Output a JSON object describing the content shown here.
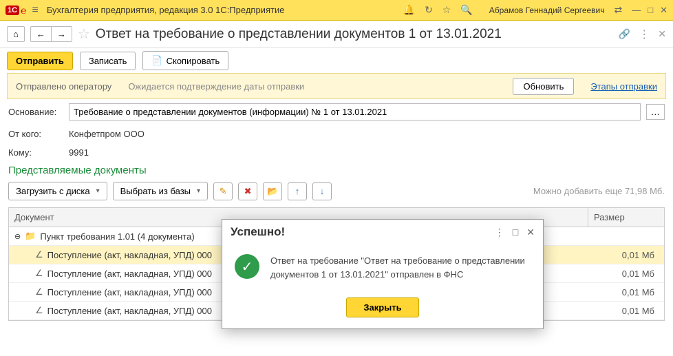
{
  "titlebar": {
    "logo_text": "℮",
    "app_title": "Бухгалтерия предприятия, редакция 3.0 1С:Предприятие",
    "user_name": "Абрамов Геннадий Сергеевич"
  },
  "doc_header": {
    "title": "Ответ на требование о представлении документов 1 от 13.01.2021"
  },
  "toolbar": {
    "send": "Отправить",
    "save": "Записать",
    "copy": "Скопировать"
  },
  "status": {
    "label": "Отправлено оператору",
    "waiting": "Ожидается подтверждение даты отправки",
    "refresh": "Обновить",
    "stages": "Этапы отправки"
  },
  "form": {
    "basis_label": "Основание:",
    "basis_value": "Требование о представлении документов (информации) № 1 от 13.01.2021",
    "from_label": "От кого:",
    "from_value": "Конфетпром ООО",
    "to_label": "Кому:",
    "to_value": "9991"
  },
  "section": {
    "title": "Представляемые документы"
  },
  "doc_toolbar": {
    "load_disk": "Загрузить с диска",
    "select_base": "Выбрать из базы",
    "hint": "Можно добавить еще 71,98 Мб."
  },
  "table": {
    "col_doc": "Документ",
    "col_size": "Размер",
    "group": "Пункт требования 1.01 (4 документа)",
    "rows": [
      {
        "text": "Поступление (акт, накладная, УПД) 000",
        "size": "0,01 Мб"
      },
      {
        "text": "Поступление (акт, накладная, УПД) 000",
        "size": "0,01 Мб"
      },
      {
        "text": "Поступление (акт, накладная, УПД) 000",
        "size": "0,01 Мб"
      },
      {
        "text": "Поступление (акт, накладная, УПД) 000",
        "size": "0,01 Мб"
      }
    ]
  },
  "dialog": {
    "title": "Успешно!",
    "message": "Ответ на требование \"Ответ на требование о представлении документов 1 от 13.01.2021\" отправлен в ФНС",
    "close": "Закрыть"
  }
}
